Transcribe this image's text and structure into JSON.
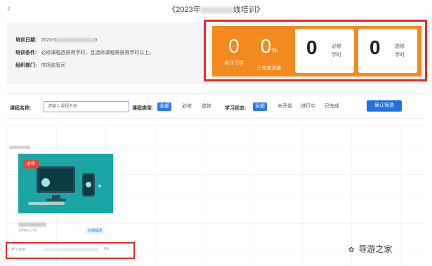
{
  "header": {
    "back_icon": "chevron-left-icon",
    "title_prefix": "《2023年",
    "title_suffix": "线培训》"
  },
  "info": {
    "date_label": "培训日期:",
    "date_value": "2023-0",
    "date_value_tail": "0",
    "condition_label": "培训条件:",
    "condition_value": "必修课程选获得学时，且选修课程需获得学时以上。",
    "dept_label": "组织部门:",
    "dept_value": "市场监管司"
  },
  "stats": {
    "total_hours_value": "0",
    "total_hours_label": "合计已学",
    "completion_value": "0",
    "completion_unit": "%",
    "completion_label": "已完成进度",
    "required_value": "0",
    "required_label_1": "必修",
    "required_label_2": "学时",
    "elective_value": "0",
    "elective_label_1": "选修",
    "elective_label_2": "学时"
  },
  "filters": {
    "course_name_label": "课程名称:",
    "course_name_placeholder": "请输入课程名称",
    "course_type_label": "课程类型:",
    "course_type_options": [
      "全部",
      "必修",
      "选修"
    ],
    "course_type_selected": "全部",
    "status_label": "学习状态:",
    "status_options": [
      "全部",
      "未开始",
      "进行中",
      "已完成"
    ],
    "status_selected": "全部",
    "confirm_label": "确认筛选"
  },
  "course_card": {
    "badge": "必修",
    "meta": "1学时/1小时",
    "tag": "在课程通",
    "progress_label": "学习进度",
    "progress_value": 0,
    "progress_text": "0%"
  },
  "watermark": {
    "text": "导游之家",
    "icon": "wechat-icon"
  },
  "colors": {
    "accent_orange": "#f28a1e",
    "highlight_red": "#e02a2a",
    "primary_blue": "#2a7ae4",
    "thumb_teal": "#1ba6a6"
  }
}
